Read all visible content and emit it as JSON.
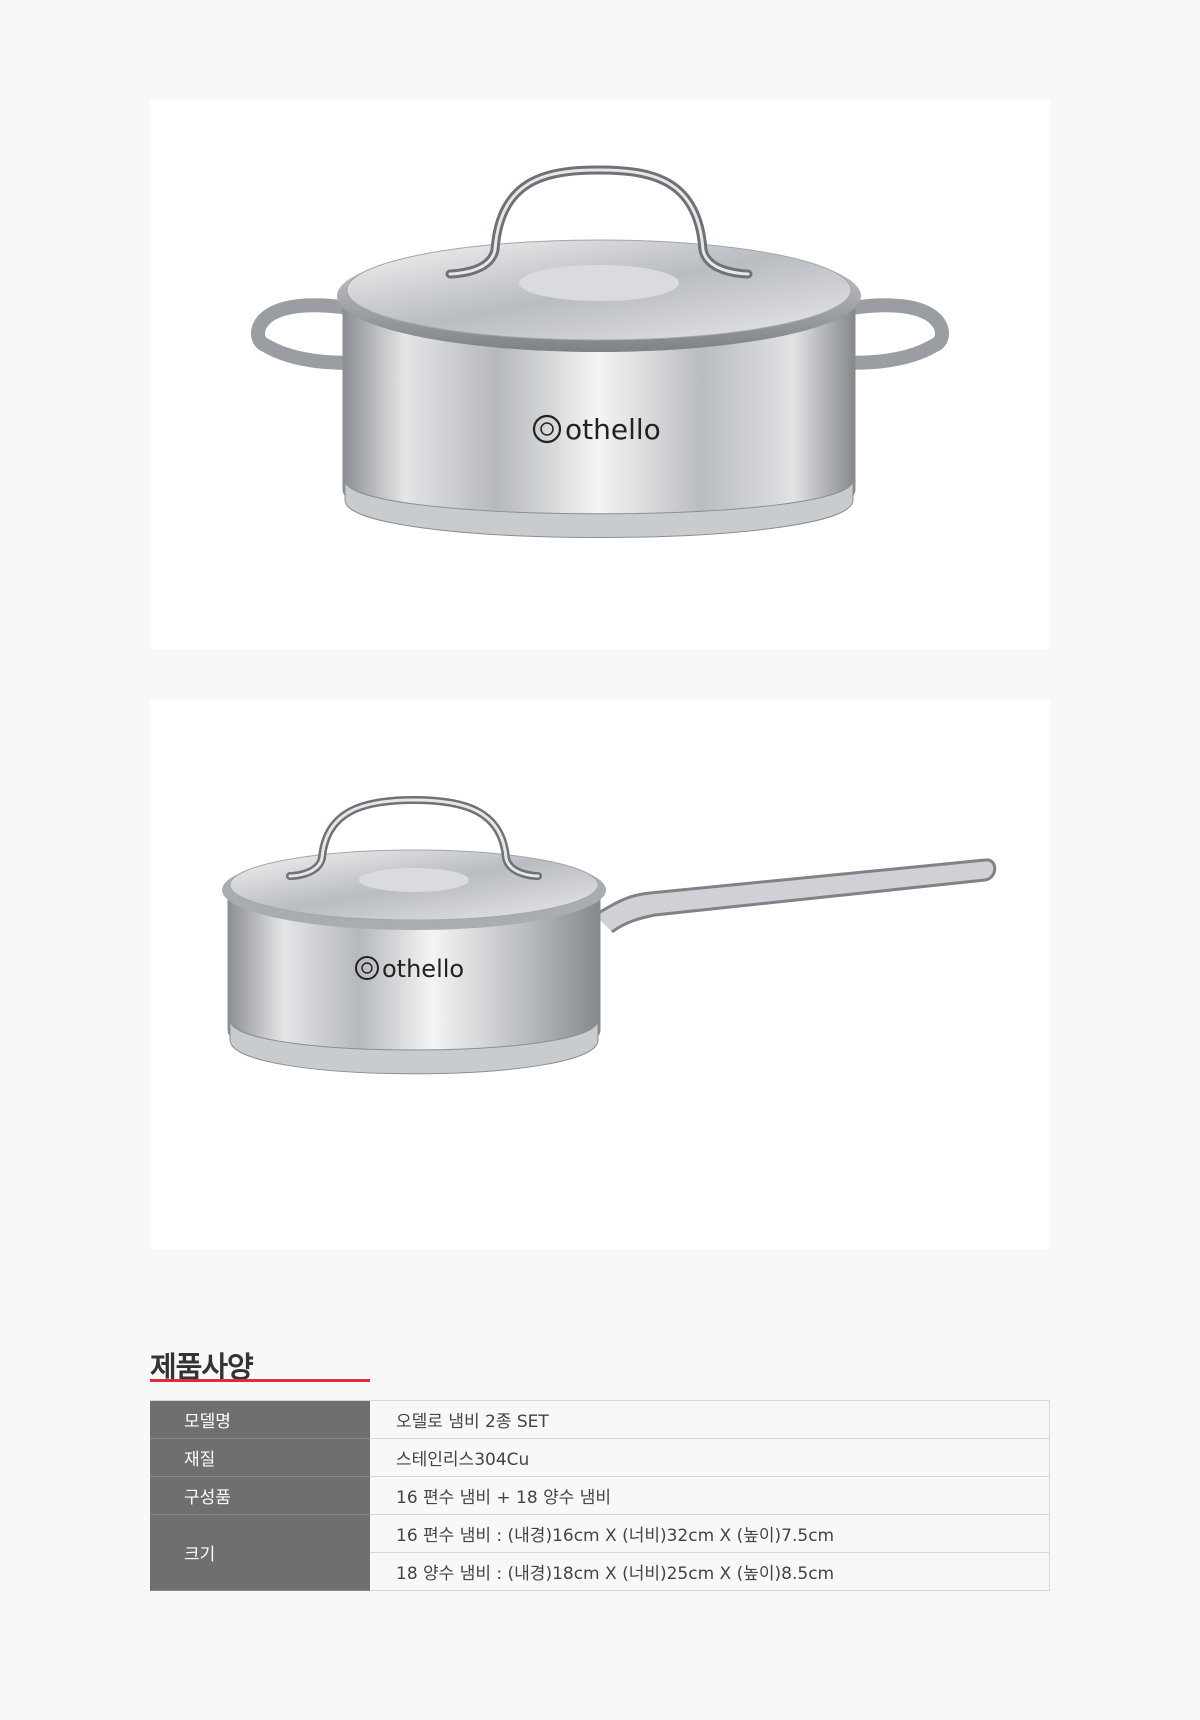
{
  "product_images": [
    {
      "logo_text": "othello"
    },
    {
      "logo_text": "othello"
    }
  ],
  "spec": {
    "title": "제품사양",
    "rows": [
      {
        "label": "모델명",
        "value": "오델로 냄비 2종 SET"
      },
      {
        "label": "재질",
        "value": "스테인리스304Cu"
      },
      {
        "label": "구성품",
        "value": "16 편수 냄비 + 18 양수 냄비"
      },
      {
        "label": "크기",
        "values": [
          "16 편수 냄비 : (내경)16cm X (너비)32cm X (높이)7.5cm",
          "18 양수 냄비 : (내경)18cm X (너비)25cm X (높이)8.5cm"
        ]
      }
    ]
  },
  "colors": {
    "accent": "#e12b3c",
    "label_bg": "#6f6f72"
  }
}
